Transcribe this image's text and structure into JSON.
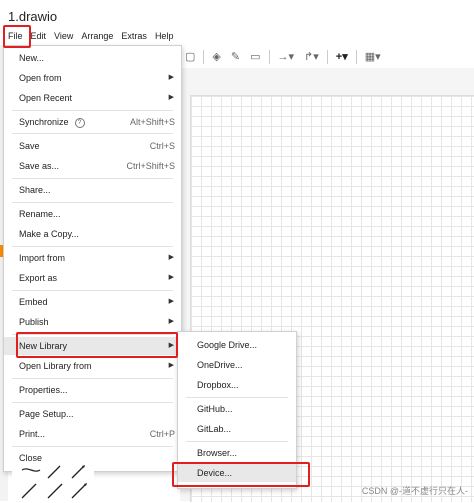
{
  "app": {
    "title": "1.drawio"
  },
  "menubar": [
    "File",
    "Edit",
    "View",
    "Arrange",
    "Extras",
    "Help"
  ],
  "toolbar": {
    "add_symbol": "+"
  },
  "file_menu": {
    "items": [
      {
        "label": "New...",
        "shortcut": "",
        "submenu": false
      },
      {
        "label": "Open from",
        "shortcut": "",
        "submenu": true
      },
      {
        "label": "Open Recent",
        "shortcut": "",
        "submenu": true
      },
      {
        "label": "Synchronize",
        "shortcut": "Alt+Shift+S",
        "submenu": false
      },
      {
        "label": "Save",
        "shortcut": "Ctrl+S",
        "submenu": false
      },
      {
        "label": "Save as...",
        "shortcut": "Ctrl+Shift+S",
        "submenu": false
      },
      {
        "label": "Share...",
        "shortcut": "",
        "submenu": false
      },
      {
        "label": "Rename...",
        "shortcut": "",
        "submenu": false
      },
      {
        "label": "Make a Copy...",
        "shortcut": "",
        "submenu": false
      },
      {
        "label": "Import from",
        "shortcut": "",
        "submenu": true
      },
      {
        "label": "Export as",
        "shortcut": "",
        "submenu": true
      },
      {
        "label": "Embed",
        "shortcut": "",
        "submenu": true
      },
      {
        "label": "Publish",
        "shortcut": "",
        "submenu": true
      },
      {
        "label": "New Library",
        "shortcut": "",
        "submenu": true
      },
      {
        "label": "Open Library from",
        "shortcut": "",
        "submenu": true
      },
      {
        "label": "Properties...",
        "shortcut": "",
        "submenu": false
      },
      {
        "label": "Page Setup...",
        "shortcut": "",
        "submenu": false
      },
      {
        "label": "Print...",
        "shortcut": "Ctrl+P",
        "submenu": false
      },
      {
        "label": "Close",
        "shortcut": "",
        "submenu": false
      }
    ]
  },
  "library_submenu": {
    "items": [
      "Google Drive...",
      "OneDrive...",
      "Dropbox...",
      "GitHub...",
      "GitLab...",
      "Browser...",
      "Device..."
    ]
  },
  "watermark": "CSDN @-道不虚行只在人-",
  "colors": {
    "highlight_border": "#e02020",
    "menu_selection": "#e8e8e8"
  }
}
